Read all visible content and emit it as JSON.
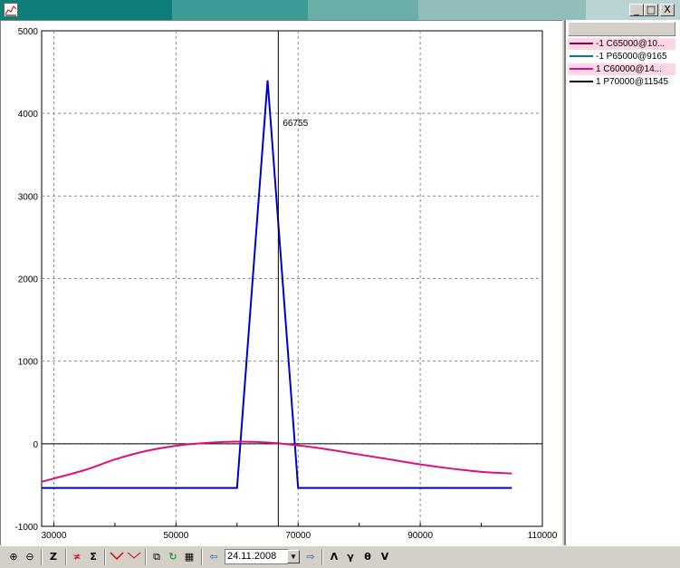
{
  "window": {
    "app_icon": "chart-icon",
    "minimize_label": "_",
    "maximize_label": "□",
    "close_label": "X"
  },
  "legend": {
    "items": [
      {
        "label": "-1 C65000@10...",
        "color": "#8b004b",
        "highlight": "#ffd6e6"
      },
      {
        "label": "-1 P65000@9165",
        "color": "#008080",
        "highlight": "#ffffff"
      },
      {
        "label": "1 C60000@14...",
        "color": "#e0107a",
        "highlight": "#ffd6e6"
      },
      {
        "label": "1 P70000@11545",
        "color": "#000000",
        "highlight": "#ffffff"
      }
    ]
  },
  "toolbar": {
    "zoom_in_icon": "zoom-in-icon",
    "zoom_out_icon": "zoom-out-icon",
    "z_label": "Z",
    "sigma_label": "Σ",
    "date_value": "24.11.2008",
    "alpha_label": "Λ",
    "gamma_label": "γ",
    "theta_label": "θ",
    "vega_label": "V"
  },
  "chart_data": {
    "type": "line",
    "xlim": [
      28000,
      110000
    ],
    "ylim": [
      -1000,
      5000
    ],
    "x_ticks": [
      30000,
      50000,
      70000,
      90000,
      110000
    ],
    "y_ticks": [
      -1000,
      0,
      1000,
      2000,
      3000,
      4000,
      5000
    ],
    "x_tick_labels": [
      "30000",
      "50000",
      "70000",
      "90000",
      "110000"
    ],
    "y_tick_labels": [
      "-1000",
      "0",
      "1000",
      "2000",
      "3000",
      "4000",
      "5000"
    ],
    "grid": true,
    "cursor_x": 66755,
    "cursor_label": "66755",
    "series": [
      {
        "color": "#0000cc",
        "x": [
          28000,
          60000,
          65000,
          70000,
          105000
        ],
        "y": [
          -535,
          -535,
          4400,
          -535,
          -535
        ]
      },
      {
        "color": "#e0107a",
        "x": [
          28000,
          35000,
          40000,
          45000,
          50000,
          55000,
          60000,
          65000,
          70000,
          75000,
          80000,
          85000,
          90000,
          95000,
          100000,
          105000
        ],
        "y": [
          -460,
          -320,
          -190,
          -90,
          -25,
          10,
          25,
          15,
          -20,
          -70,
          -130,
          -190,
          -250,
          -300,
          -340,
          -360
        ]
      }
    ]
  }
}
